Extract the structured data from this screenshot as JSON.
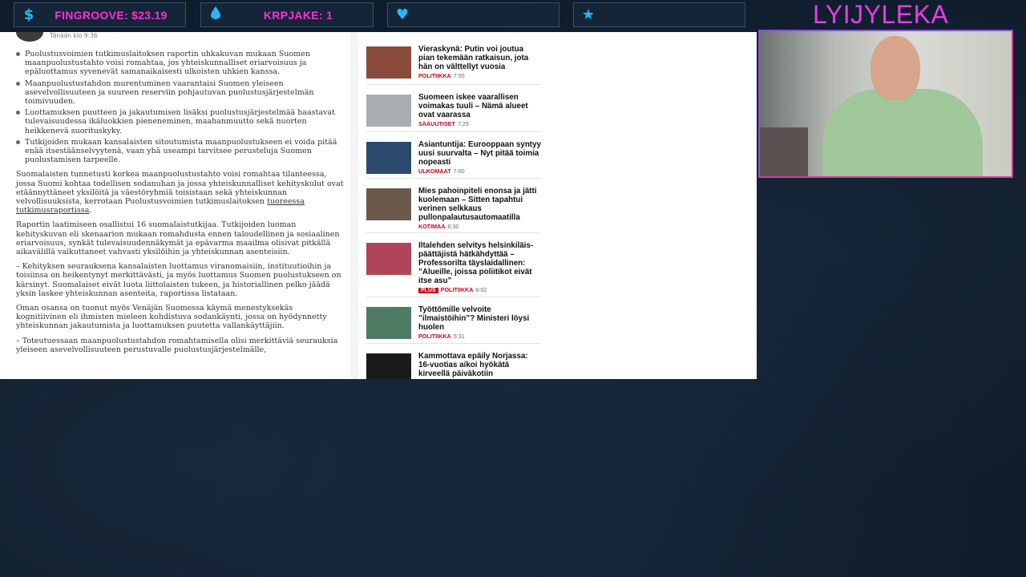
{
  "overlay": {
    "stats": [
      {
        "icon": "dollar-icon",
        "glyph": "$",
        "text": "FINGROOVE: $23.19"
      },
      {
        "icon": "drop-icon",
        "glyph": "💧",
        "text": "KRPJAKE: 1"
      },
      {
        "icon": "heart-icon",
        "glyph": "♥",
        "text": ""
      },
      {
        "icon": "star-icon",
        "glyph": "★",
        "text": ""
      }
    ],
    "streamer_name": "LYIJYLEKA",
    "accent": "#ff2fd8",
    "icon_color": "#29b6f6"
  },
  "article": {
    "byline_time": "Tänään klo 9:36",
    "bullets": [
      "Puolustusvoimien tutkimuslaitoksen raportin uhkakuvan mukaan Suomen maanpuolustustahto voisi romahtaa, jos yhteiskunnalliset eriarvoisuus ja epäluottamus syvenevät samanaikaisesti ulkoisten uhkien kanssa.",
      "Maanpuolustustahdon murentuminen vaarantaisi Suomen yleiseen asevelvollisuuteen ja suureen reserviin pohjautuvan puolustusjärjestelmän toimivuuden.",
      "Luottamuksen puutteen ja jakautumisen lisäksi puolustusjärjestelmää haastavat tulevaisuudessa ikäluokkien pieneneminen, maahanmuutto sekä nuorten heikkenevä suorituskyky.",
      "Tutkijoiden mukaan kansalaisten sitoutumista maanpuolustukseen ei voida pitää enää itsestäänselvyytenä, vaan yhä useampi tarvitsee perusteluja Suomen puolustamisen tarpeelle."
    ],
    "para1_text": "Suomalaisten tunnetusti korkea maanpuolustustahto voisi romahtaa tilanteessa, jossa Suomi kohtaa todellisen sodanuhan ja jossa yhteiskunnalliset kehityskulut ovat etäännyttäneet yksilöitä ja väestöryhmiä toisistaan sekä yhteiskunnan velvollisuuksista, kerrotaan Puolustusvoimien tutkimuslaitoksen ",
    "para1_link": "tuoreessa tutkimusraportissa",
    "para1_end": ".",
    "para2": "Raportin laatimiseen osallistui 16 suomalaistutkijaa. Tutkijoiden luoman kehityskuvan eli skenaarion mukaan romahdusta ennen taloudellinen ja sosiaalinen eriarvoisuus, synkät tulevaisuudennäkymät ja epävarma maailma olisivat pitkällä aikavälillä vaikuttaneet vahvasti yksilöihin ja yhteiskunnan asenteisiin.",
    "para3": "– Kehityksen seurauksena kansalaisten luottamus viranomaisiin, instituutioihin ja toisiinsa on heikentynyt merkittävästi, ja myös luottamus Suomen puolustukseen on kärsinyt. Suomalaiset eivät luota liittolaisten tukeen, ja historiallinen pelko jäädä yksin laskee yhteiskunnan asenteita, raportissa listataan.",
    "para4": "Oman osansa on tuonut myös Venäjän Suomessa käymä menestyksekäs kognitiivinen eli ihmisten mieleen kohdistuva sodankäynti, jossa on hyödynnetty yhteiskunnan jakautumista ja luottamuksen puutetta vallankäyttäjiin.",
    "para5": "– Toteutuessaan maanpuolustustahdon romahtamisella olisi merkittäviä seurauksia yleiseen asevelvollisuuteen perustuvalle puolustusjärjestelmälle,"
  },
  "news": [
    {
      "title": "Vieraskynä: Putin voi joutua pian tekemään ratkaisun, jota hän on välttellyt vuosia",
      "category": "POLITIIKKA",
      "time": "7:55",
      "plus": false,
      "thumb_color": "#8a4b3c"
    },
    {
      "title": "Suomeen iskee vaarallisen voimakas tuuli – Nämä alueet ovat vaarassa",
      "category": "SÄÄUUTISET",
      "time": "7:25",
      "plus": false,
      "thumb_color": "#a9aeb0"
    },
    {
      "title": "Asiantuntija: Eurooppaan syntyy uusi suurvalta – Nyt pitää toimia nopeasti",
      "category": "ULKOMAAT",
      "time": "7:00",
      "plus": false,
      "thumb_color": "#2c4a6e"
    },
    {
      "title": "Mies pahoinpiteli enonsa ja jätti kuolemaan – Sitten tapahtui verinen selkkaus pullonpalautusautomaatilla",
      "category": "KOTIMAA",
      "time": "6:30",
      "plus": false,
      "thumb_color": "#6b5a4c"
    },
    {
      "title": "Iltalehden selvitys helsinkiläis-päättäjistä hätkähdyttää – Professorilta täyslaidallinen: ”Alueille, joissa poliitikot eivät itse asu”",
      "category": "POLITIIKKA",
      "time": "6:02",
      "plus": true,
      "plus_label": "PLUS",
      "thumb_color": "#b0455a"
    },
    {
      "title": "Työttömille velvoite ”ilmaistöihin”? Ministeri löysi huolen",
      "category": "POLITIIKKA",
      "time": "5:31",
      "plus": false,
      "thumb_color": "#4f7a64"
    },
    {
      "title": "Kammottava epäily Norjassa: 16-vuotias aikoi hyökätä kirveellä päiväkotiin",
      "category": "",
      "time": "",
      "plus": false,
      "thumb_color": "#1a1a1a"
    }
  ]
}
